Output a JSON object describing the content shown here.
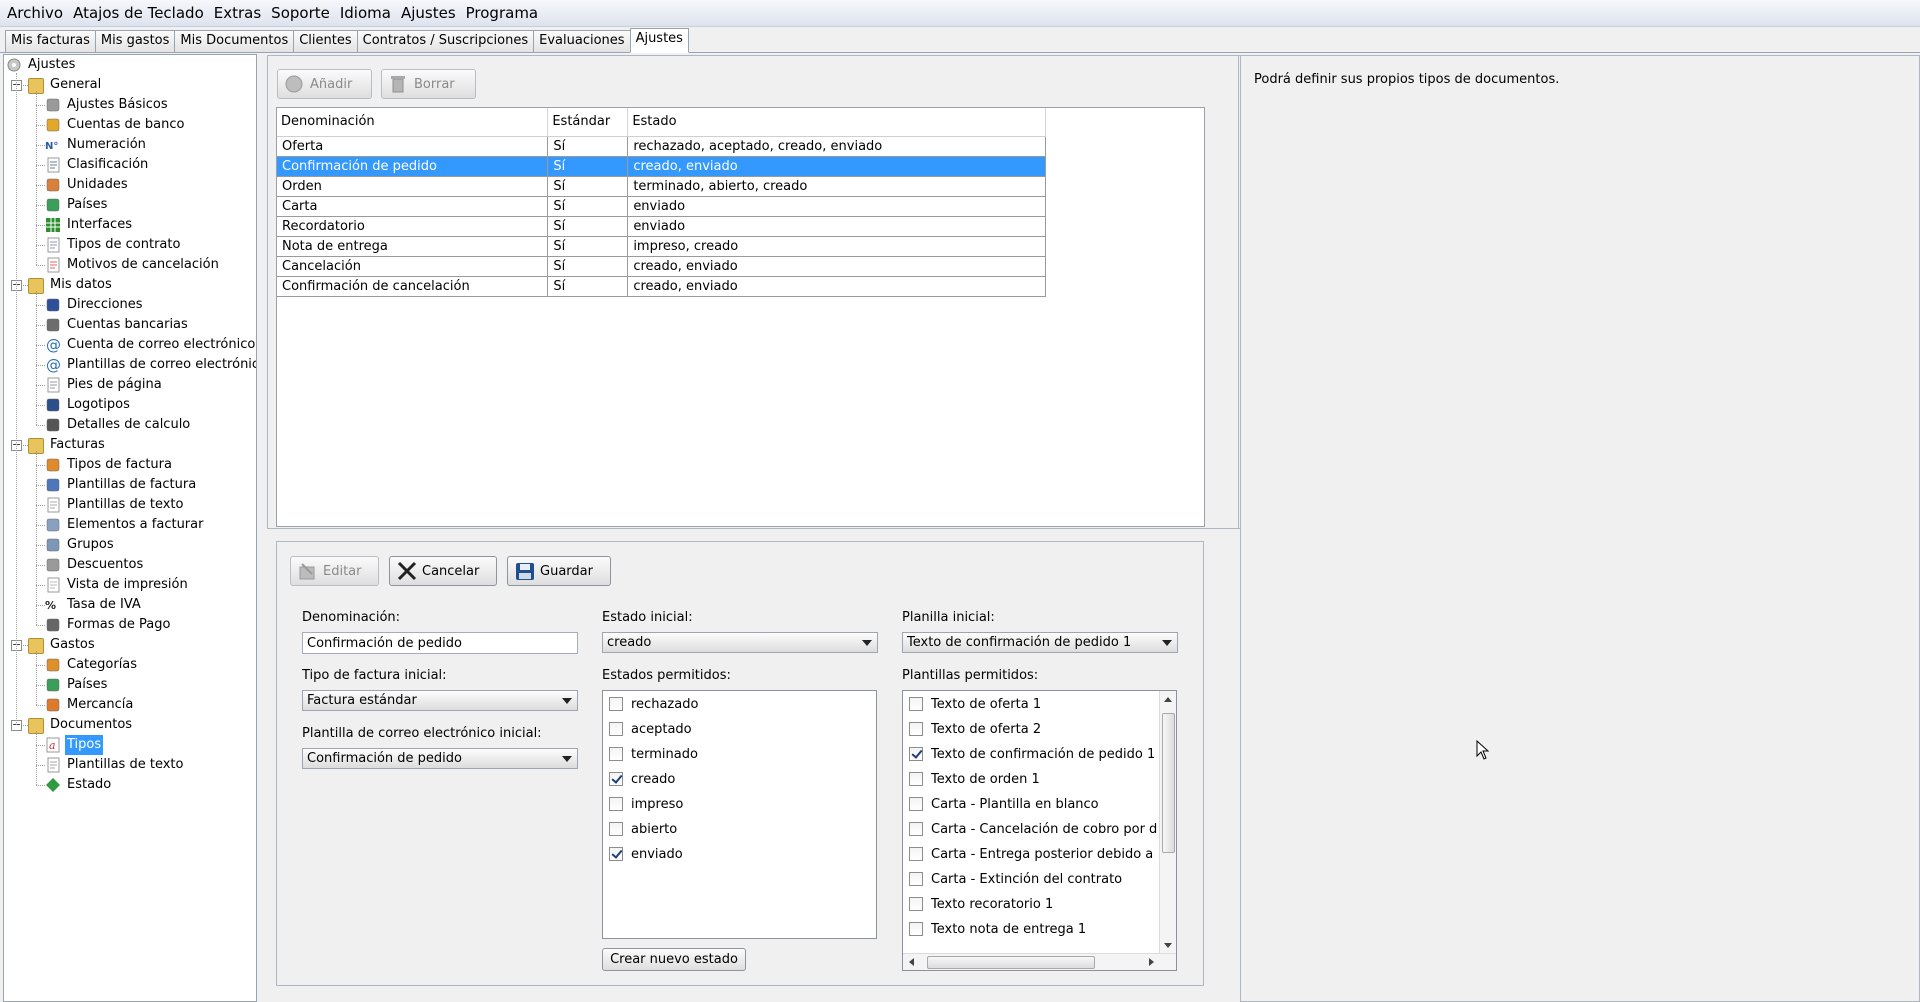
{
  "menu": [
    "Archivo",
    "Atajos de Teclado",
    "Extras",
    "Soporte",
    "Idioma",
    "Ajustes",
    "Programa"
  ],
  "tabs": [
    {
      "label": "Mis facturas",
      "active": false
    },
    {
      "label": "Mis gastos",
      "active": false
    },
    {
      "label": "Mis Documentos",
      "active": false
    },
    {
      "label": "Clientes",
      "active": false
    },
    {
      "label": "Contratos / Suscripciones",
      "active": false
    },
    {
      "label": "Evaluaciones",
      "active": false
    },
    {
      "label": "Ajustes",
      "active": true
    }
  ],
  "tree": {
    "root": "Ajustes",
    "groups": [
      {
        "label": "General",
        "items": [
          {
            "label": "Ajustes Básicos",
            "icon": "gears-icon"
          },
          {
            "label": "Cuentas de banco",
            "icon": "bank-icon"
          },
          {
            "label": "Numeración",
            "icon": "number-sign-icon"
          },
          {
            "label": "Clasificación",
            "icon": "classification-icon"
          },
          {
            "label": "Unidades",
            "icon": "units-icon"
          },
          {
            "label": "Países",
            "icon": "globe-icon"
          },
          {
            "label": "Interfaces",
            "icon": "grid-icon"
          },
          {
            "label": "Tipos de contrato",
            "icon": "contract-icon"
          },
          {
            "label": "Motivos de cancelación",
            "icon": "cancel-doc-icon"
          }
        ]
      },
      {
        "label": "Mis datos",
        "items": [
          {
            "label": "Direcciones",
            "icon": "address-book-icon"
          },
          {
            "label": "Cuentas bancarias",
            "icon": "card-icon"
          },
          {
            "label": "Cuenta de correo electrónico",
            "icon": "at-icon"
          },
          {
            "label": "Plantillas de correo electrónico",
            "icon": "at-template-icon"
          },
          {
            "label": "Pies de página",
            "icon": "footer-icon"
          },
          {
            "label": "Logotipos",
            "icon": "logo-icon"
          },
          {
            "label": "Detalles de calculo",
            "icon": "calculator-icon"
          }
        ]
      },
      {
        "label": "Facturas",
        "items": [
          {
            "label": "Tipos de factura",
            "icon": "invoice-types-icon"
          },
          {
            "label": "Plantillas de factura",
            "icon": "invoice-template-icon"
          },
          {
            "label": "Plantillas de texto",
            "icon": "text-template-icon"
          },
          {
            "label": "Elementos a facturar",
            "icon": "items-icon"
          },
          {
            "label": "Grupos",
            "icon": "groups-icon"
          },
          {
            "label": "Descuentos",
            "icon": "discount-icon"
          },
          {
            "label": "Vista de impresión",
            "icon": "print-preview-icon"
          },
          {
            "label": "Tasa de IVA",
            "icon": "percent-icon"
          },
          {
            "label": "Formas de Pago",
            "icon": "payment-icon"
          }
        ]
      },
      {
        "label": "Gastos",
        "items": [
          {
            "label": "Categorías",
            "icon": "categories-icon"
          },
          {
            "label": "Países",
            "icon": "globe-icon"
          },
          {
            "label": "Mercancía",
            "icon": "goods-icon"
          }
        ]
      },
      {
        "label": "Documentos",
        "items": [
          {
            "label": "Tipos",
            "icon": "types-icon",
            "selected": true
          },
          {
            "label": "Plantillas de texto",
            "icon": "text-template-icon"
          },
          {
            "label": "Estado",
            "icon": "status-diamond-icon"
          }
        ]
      }
    ]
  },
  "top_toolbar": {
    "add_label": "Añadir",
    "delete_label": "Borrar"
  },
  "doc_table": {
    "columns": [
      "Denominación",
      "Estándar",
      "Estado"
    ],
    "rows": [
      [
        "Oferta",
        "Sí",
        "rechazado, aceptado, creado, enviado"
      ],
      [
        "Confirmación de pedido",
        "Sí",
        "creado, enviado"
      ],
      [
        "Orden",
        "Sí",
        "terminado, abierto, creado"
      ],
      [
        "Carta",
        "Sí",
        "enviado"
      ],
      [
        "Recordatorio",
        "Sí",
        "enviado"
      ],
      [
        "Nota de entrega",
        "Sí",
        "impreso, creado"
      ],
      [
        "Cancelación",
        "Sí",
        "creado, enviado"
      ],
      [
        "Confirmación de cancelación",
        "Sí",
        "creado, enviado"
      ]
    ],
    "selected_row": 1
  },
  "edit_toolbar": {
    "edit_label": "Editar",
    "cancel_label": "Cancelar",
    "save_label": "Guardar"
  },
  "form": {
    "name_label": "Denominación:",
    "name_value": "Confirmación de pedido",
    "invoice_type_label": "Tipo de factura inicial:",
    "invoice_type_value": "Factura estándar",
    "email_template_label": "Plantilla de correo electrónico inicial:",
    "email_template_value": "Confirmación de pedido",
    "initial_state_label": "Estado inicial:",
    "initial_state_value": "creado",
    "allowed_states_label": "Estados permitidos:",
    "allowed_states": [
      {
        "label": "rechazado",
        "checked": false
      },
      {
        "label": "aceptado",
        "checked": false
      },
      {
        "label": "terminado",
        "checked": false
      },
      {
        "label": "creado",
        "checked": true
      },
      {
        "label": "impreso",
        "checked": false
      },
      {
        "label": "abierto",
        "checked": false
      },
      {
        "label": "enviado",
        "checked": true
      }
    ],
    "new_state_button": "Crear nuevo estado",
    "initial_template_label": "Planilla inicial:",
    "initial_template_value": "Texto de confirmación de pedido 1",
    "allowed_templates_label": "Plantillas permitidos:",
    "allowed_templates": [
      {
        "label": "Texto de oferta  1",
        "checked": false
      },
      {
        "label": "Texto de oferta 2",
        "checked": false
      },
      {
        "label": "Texto de confirmación de pedido 1",
        "checked": true
      },
      {
        "label": "Texto de orden 1",
        "checked": false
      },
      {
        "label": "Carta - Plantilla en blanco",
        "checked": false
      },
      {
        "label": "Carta - Cancelación de cobro por débito",
        "checked": false
      },
      {
        "label": "Carta - Entrega  posterior debido a falla",
        "checked": false
      },
      {
        "label": "Carta - Extinción del contrato",
        "checked": false
      },
      {
        "label": "Texto recoratorio 1",
        "checked": false
      },
      {
        "label": "Texto nota de entrega 1",
        "checked": false
      }
    ]
  },
  "help_text": "Podrá definir sus propios tipos de documentos."
}
